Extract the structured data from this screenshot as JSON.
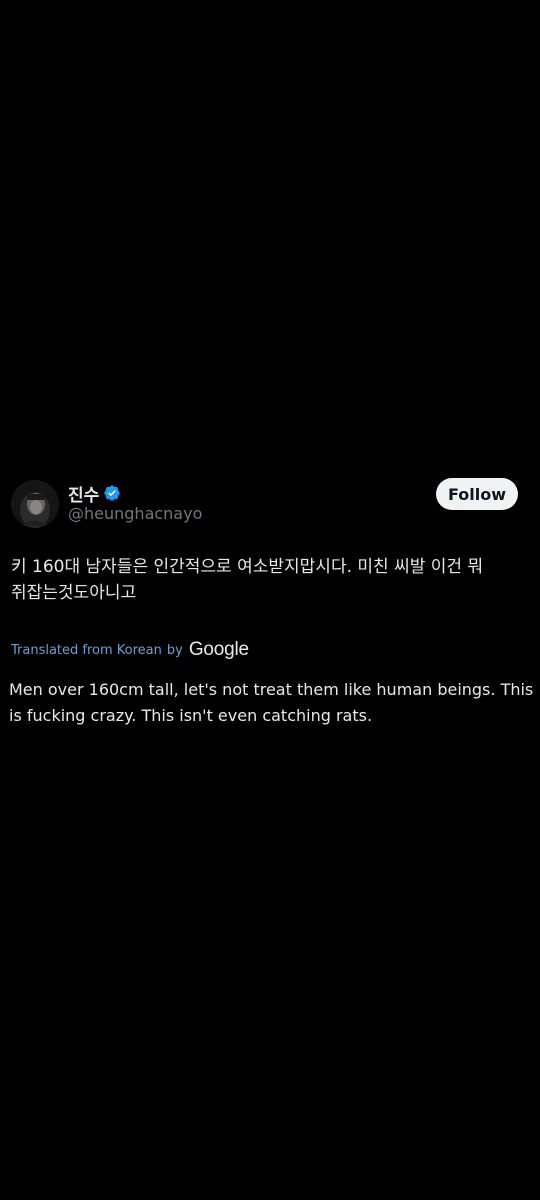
{
  "tweet": {
    "author": {
      "display_name": "진수",
      "handle": "@heunghacnayo",
      "verified": true,
      "verified_color": "#1d9bf0"
    },
    "follow_label": "Follow",
    "original_text": "키 160대 남자들은 인간적으로 여소받지맙시다. 미친 씨발 이건 뭐 쥐잡는것도아니고",
    "translation": {
      "label": "Translated from Korean",
      "by": "by",
      "provider": "Google",
      "text": "Men over 160cm tall, let's not treat them like human beings. This is fucking crazy. This isn't even catching rats."
    }
  },
  "colors": {
    "background": "#000000",
    "text": "#e7e9ea",
    "secondary_text": "#71767b",
    "link": "#6e9fd6",
    "follow_bg": "#eff3f4"
  }
}
